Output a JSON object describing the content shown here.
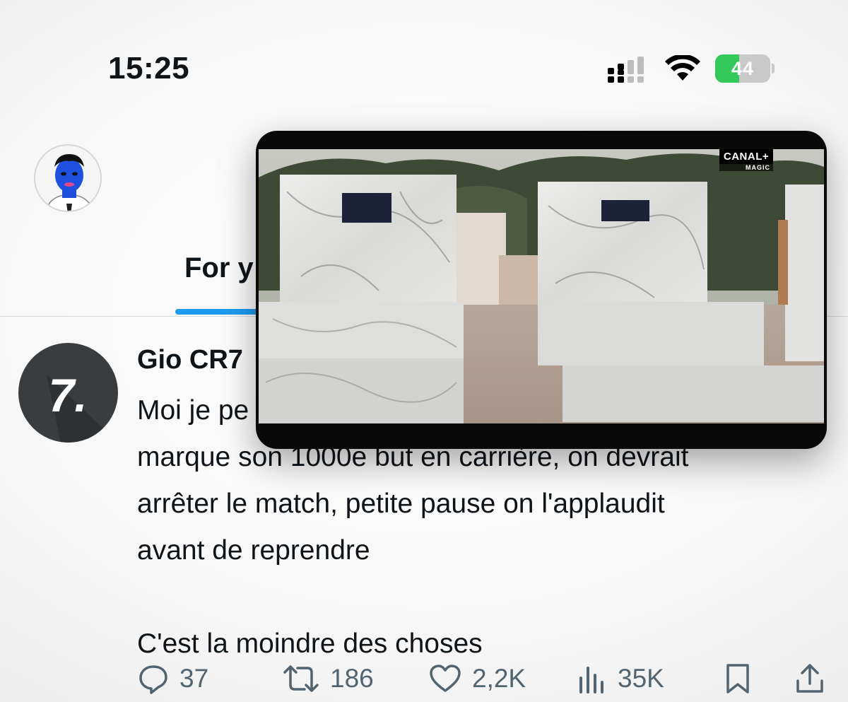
{
  "status_bar": {
    "time": "15:25",
    "battery_level": "44",
    "battery_percent": 44,
    "battery_color": "#34c759"
  },
  "header": {
    "avatar_icon": "profile-avatar-illustration",
    "tab_label": "For y"
  },
  "tweet": {
    "author_name": "Gio CR7",
    "author_avatar_glyph": "7.",
    "text_line_1": "Moi je pe",
    "text_block": "marque son 1000e but en carrière, on devrait\narrêter le match, petite pause on l'applaudit\navant de reprendre",
    "text_line_last": "C'est la moindre des choses",
    "actions": {
      "replies": "37",
      "retweets": "186",
      "likes": "2,2K",
      "views": "35K"
    }
  },
  "video_overlay": {
    "logo_text": "CANAL+",
    "logo_sub": "MAGIC"
  },
  "colors": {
    "accent": "#1d9bf0",
    "text": "#0f1419",
    "muted": "#536471"
  }
}
